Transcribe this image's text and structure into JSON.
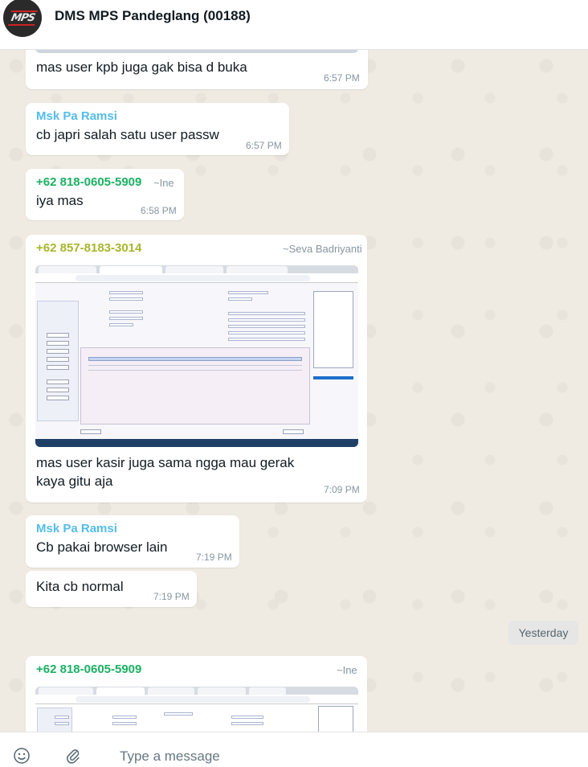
{
  "header": {
    "title": "DMS MPS Pandeglang (00188)",
    "logo_text": "MPS"
  },
  "messages": [
    {
      "text": "mas user kpb juga gak bisa d buka",
      "time": "6:57 PM"
    },
    {
      "sender": "Msk Pa Ramsi",
      "text": "cb japri salah satu user passw",
      "time": "6:57 PM"
    },
    {
      "sender": "+62 818-0605-5909",
      "alias": "~Ine",
      "text": "iya mas",
      "time": "6:58 PM"
    },
    {
      "sender": "+62 857-8183-3014",
      "alias": "~Seva Badriyanti",
      "text_line1": "mas user kasir juga sama ngga mau gerak",
      "text_line2": "kaya gitu aja",
      "time": "7:09 PM"
    },
    {
      "sender": "Msk Pa Ramsi",
      "text": "Cb pakai browser lain",
      "time": "7:19 PM"
    },
    {
      "text": "Kita cb normal",
      "time": "7:19 PM"
    },
    {
      "sender": "+62 818-0605-5909",
      "alias": "~Ine"
    }
  ],
  "date_divider": "Yesterday",
  "composer": {
    "placeholder": "Type a message",
    "emoji_icon": "smiley-icon",
    "attach_icon": "paperclip-icon"
  }
}
